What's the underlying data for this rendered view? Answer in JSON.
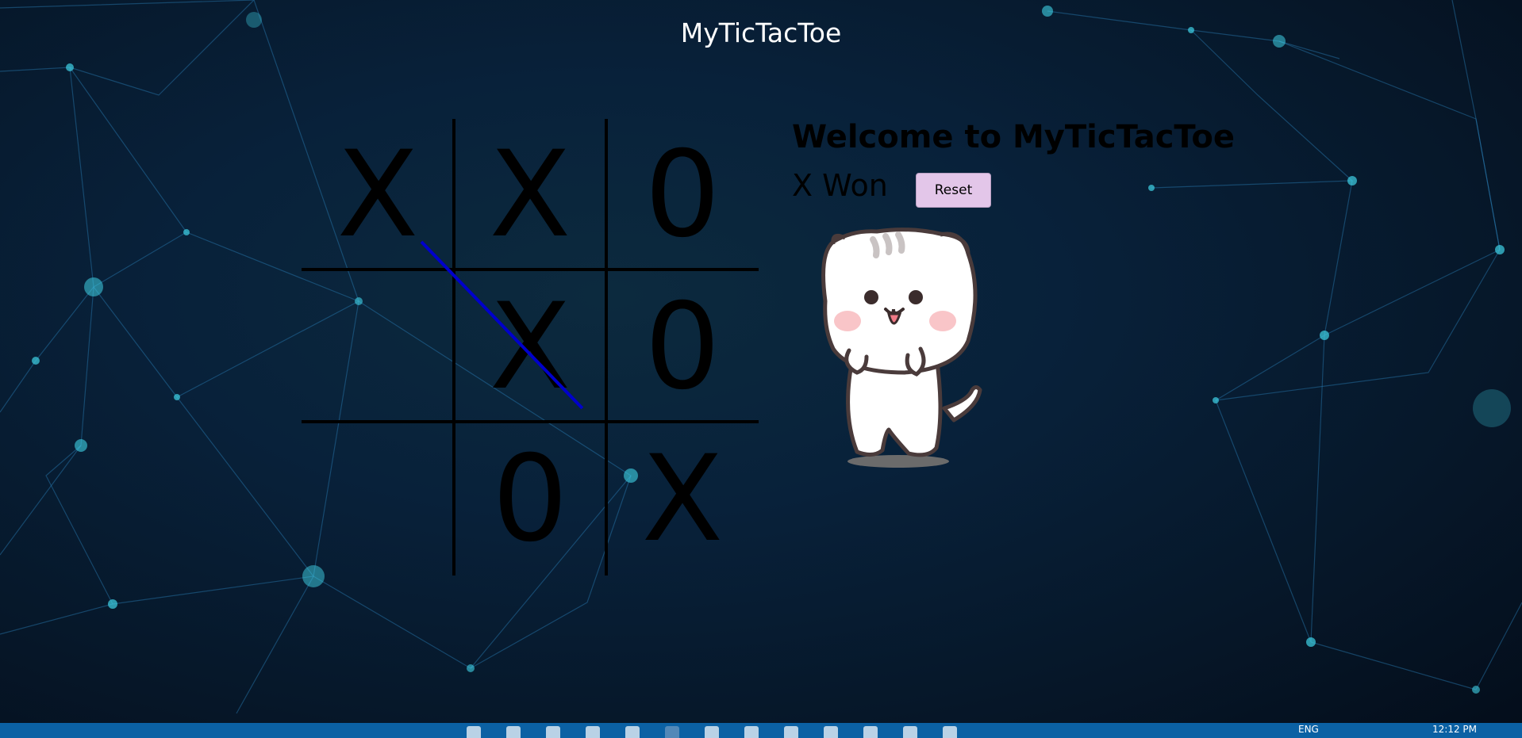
{
  "app": {
    "nav_title": "MyTicTacToe"
  },
  "game": {
    "heading": "Welcome to MyTicTacToe",
    "status": "X Won",
    "reset_label": "Reset",
    "board": [
      "X",
      "X",
      "0",
      "",
      "X",
      "0",
      "",
      "0",
      "X"
    ],
    "winning_line": [
      0,
      4,
      8
    ],
    "colors": {
      "marks": "#000000",
      "win_line": "#0000cc",
      "reset_button": "#e3c6e9"
    }
  },
  "taskbar": {
    "language": "ENG",
    "clock": "12:12 PM"
  }
}
